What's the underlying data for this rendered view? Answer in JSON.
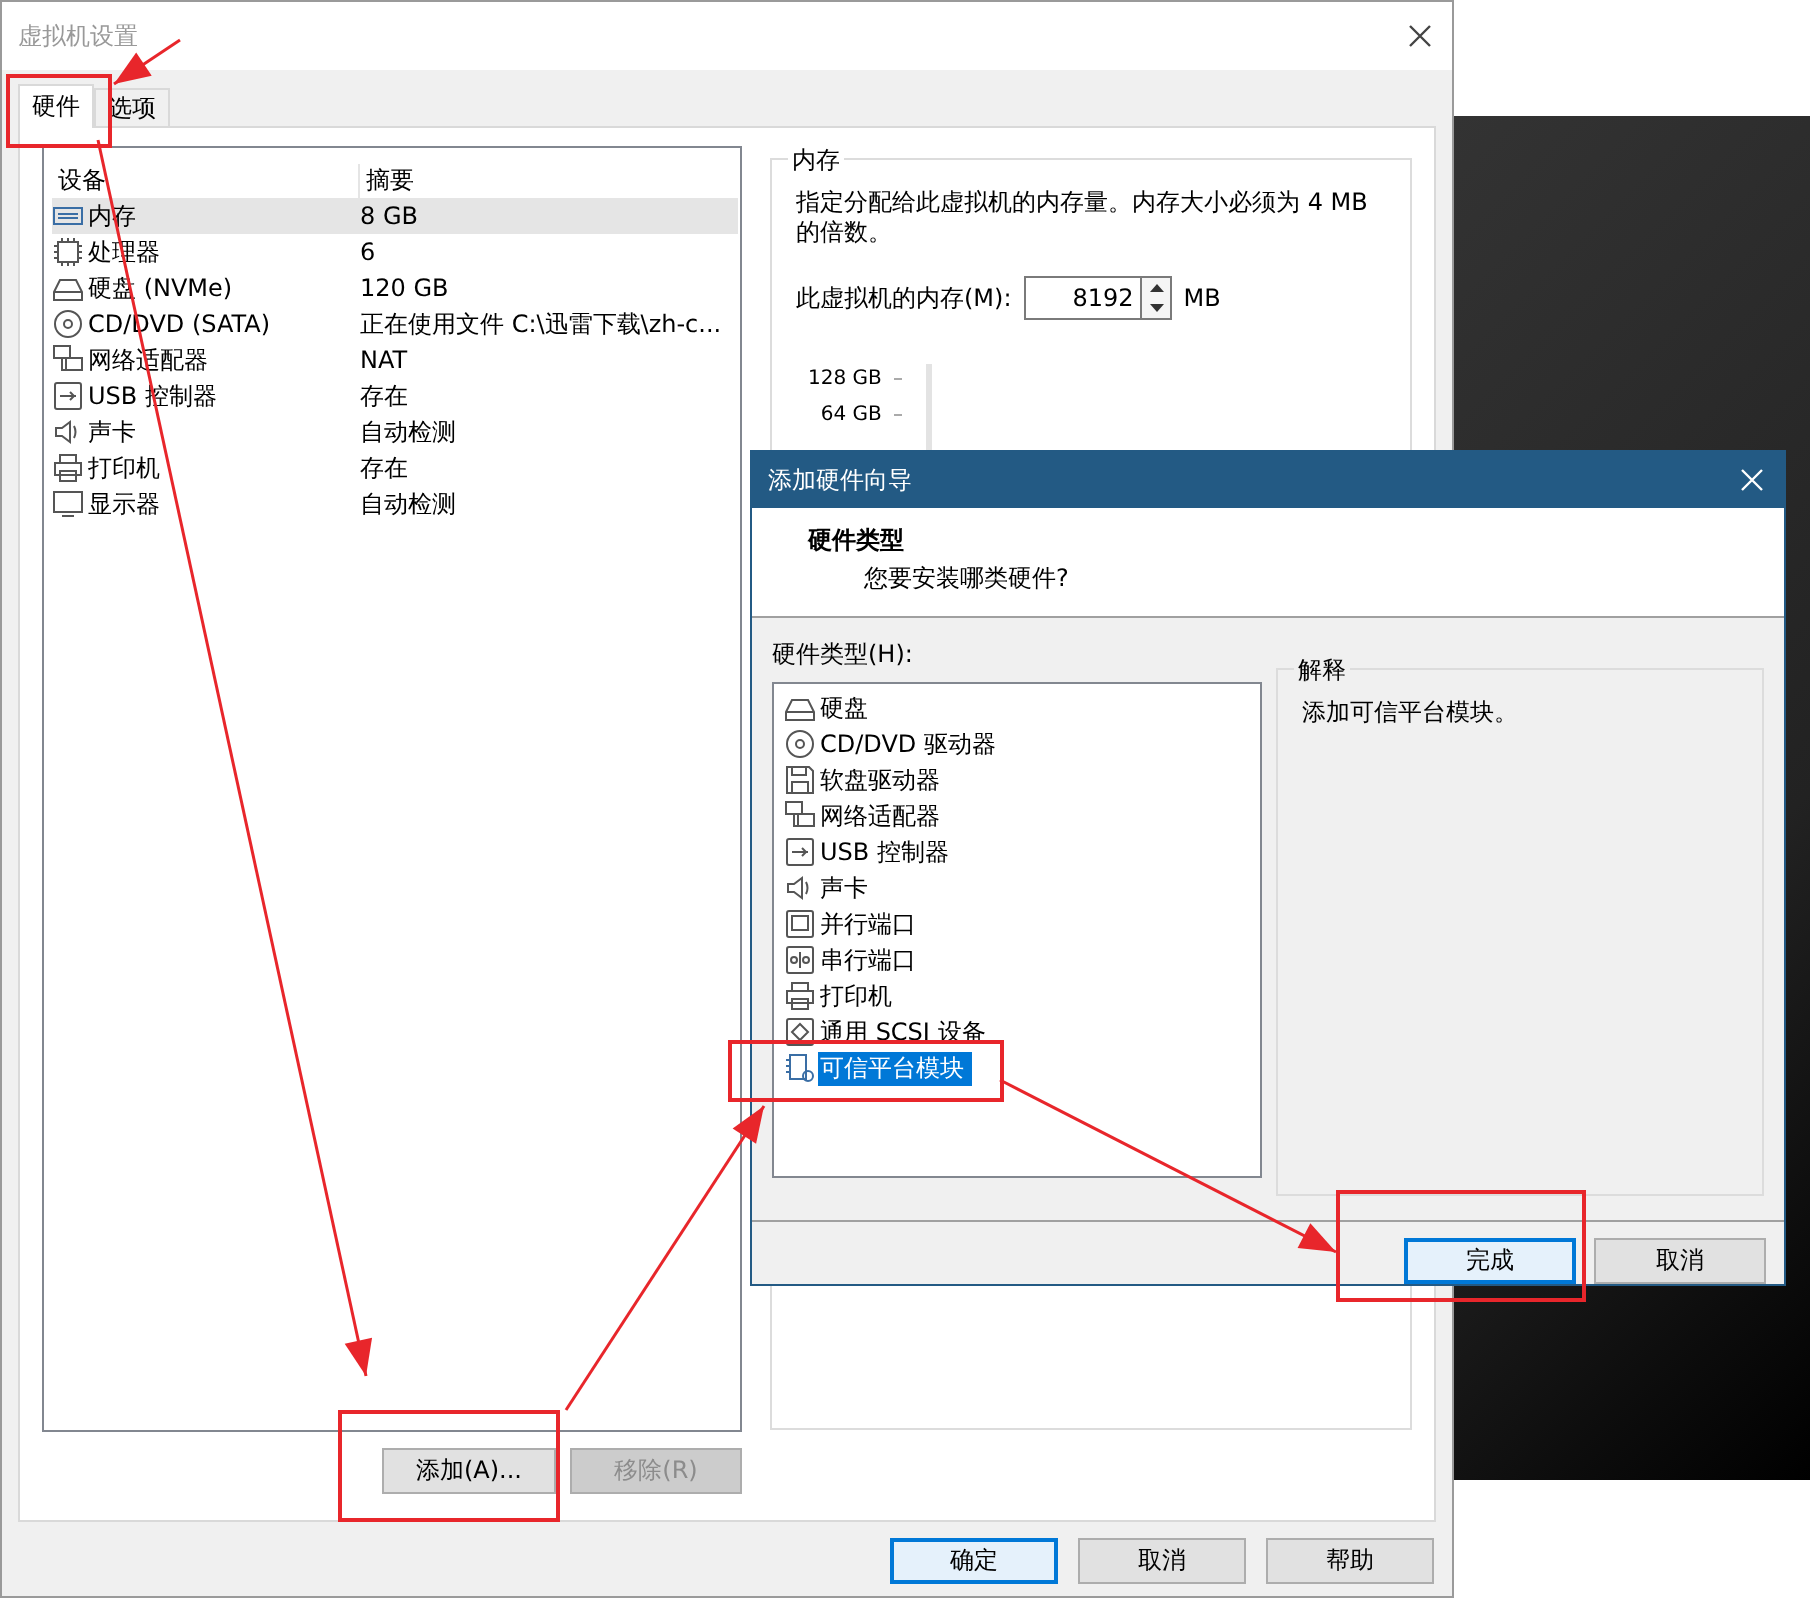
{
  "window": {
    "title": "虚拟机设置"
  },
  "tabs": [
    {
      "label": "硬件",
      "selected": true
    },
    {
      "label": "选项",
      "selected": false
    }
  ],
  "devices": {
    "columns": [
      "设备",
      "摘要"
    ],
    "rows": [
      {
        "kind": "memory",
        "name": "内存",
        "summary": "8 GB",
        "selected": true
      },
      {
        "kind": "cpu",
        "name": "处理器",
        "summary": "6",
        "selected": false
      },
      {
        "kind": "disk",
        "name": "硬盘 (NVMe)",
        "summary": "120 GB",
        "selected": false
      },
      {
        "kind": "cdrom",
        "name": "CD/DVD (SATA)",
        "summary": "正在使用文件 C:\\迅雷下载\\zh-c...",
        "selected": false
      },
      {
        "kind": "network",
        "name": "网络适配器",
        "summary": "NAT",
        "selected": false
      },
      {
        "kind": "usb",
        "name": "USB 控制器",
        "summary": "存在",
        "selected": false
      },
      {
        "kind": "sound",
        "name": "声卡",
        "summary": "自动检测",
        "selected": false
      },
      {
        "kind": "printer",
        "name": "打印机",
        "summary": "存在",
        "selected": false
      },
      {
        "kind": "display",
        "name": "显示器",
        "summary": "自动检测",
        "selected": false
      }
    ]
  },
  "device_buttons": [
    {
      "label": "添加(A)...",
      "disabled": false
    },
    {
      "label": "移除(R)",
      "disabled": true
    }
  ],
  "memory": {
    "title": "内存",
    "description": "指定分配给此虚拟机的内存量。内存大小必须为 4 MB 的倍数。",
    "field_label": "此虚拟机的内存(M):",
    "value": "8192",
    "unit": "MB",
    "scale": [
      "128 GB",
      "64 GB"
    ]
  },
  "footer_buttons": [
    {
      "label": "确定",
      "default": true
    },
    {
      "label": "取消",
      "default": false
    },
    {
      "label": "帮助",
      "default": false
    }
  ],
  "wizard": {
    "title": "添加硬件向导",
    "heading": "硬件类型",
    "subheading": "您要安装哪类硬件?",
    "list_label": "硬件类型(H):",
    "items": [
      {
        "kind": "disk",
        "label": "硬盘",
        "selected": false
      },
      {
        "kind": "cdrom",
        "label": "CD/DVD 驱动器",
        "selected": false
      },
      {
        "kind": "floppy",
        "label": "软盘驱动器",
        "selected": false
      },
      {
        "kind": "network",
        "label": "网络适配器",
        "selected": false
      },
      {
        "kind": "usb",
        "label": "USB 控制器",
        "selected": false
      },
      {
        "kind": "sound",
        "label": "声卡",
        "selected": false
      },
      {
        "kind": "parallel",
        "label": "并行端口",
        "selected": false
      },
      {
        "kind": "serial",
        "label": "串行端口",
        "selected": false
      },
      {
        "kind": "printer",
        "label": "打印机",
        "selected": false
      },
      {
        "kind": "scsi",
        "label": "通用 SCSI 设备",
        "selected": false
      },
      {
        "kind": "tpm",
        "label": "可信平台模块",
        "selected": true
      }
    ],
    "explanation_title": "解释",
    "explanation": "添加可信平台模块。",
    "buttons": [
      {
        "label": "完成",
        "default": true
      },
      {
        "label": "取消",
        "default": false
      }
    ]
  }
}
